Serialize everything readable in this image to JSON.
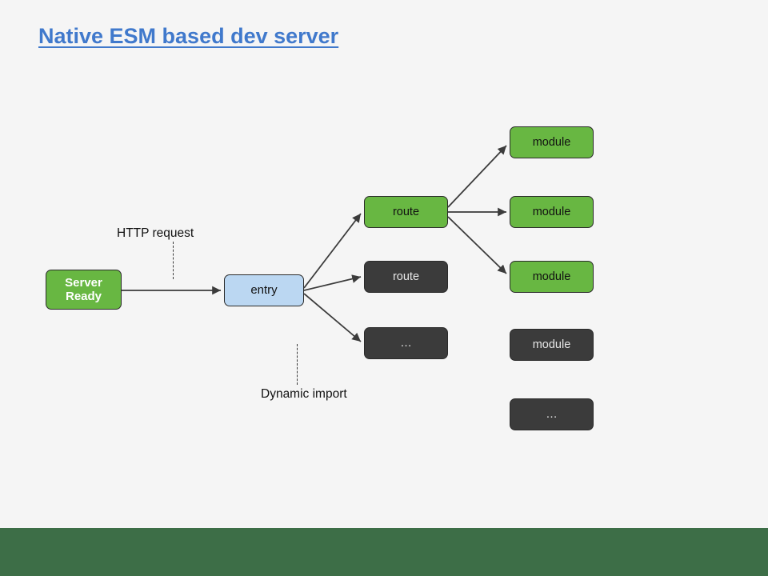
{
  "title": "Native ESM based dev server",
  "labels": {
    "http": "HTTP request",
    "dynamic": "Dynamic import"
  },
  "boxes": {
    "server": "Server Ready",
    "entry": "entry",
    "route1": "route",
    "route2": "route",
    "dots1": "…",
    "mod1": "module",
    "mod2": "module",
    "mod3": "module",
    "mod4": "module",
    "dots2": "…"
  }
}
